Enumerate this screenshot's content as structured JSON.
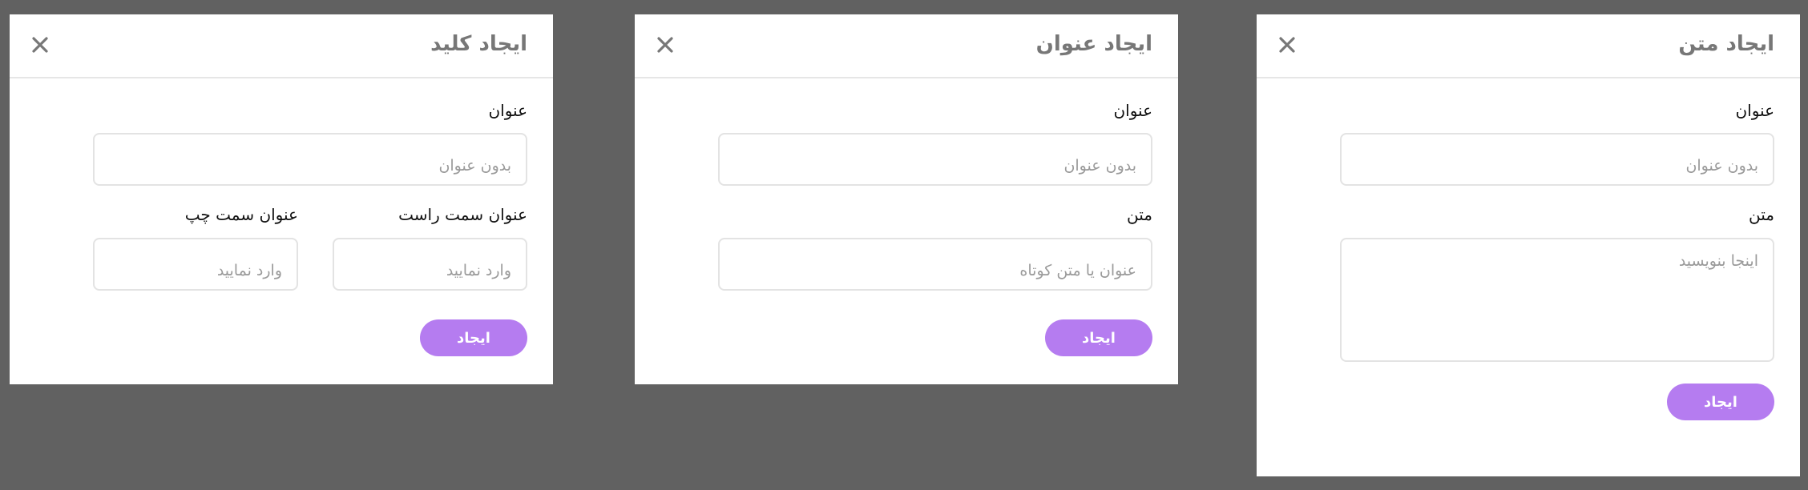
{
  "colors": {
    "backdrop": "#616161",
    "dialog_background": "#ffffff",
    "accent": "#b57cf0",
    "header_text": "#777777",
    "border": "#e3e3e3"
  },
  "dialogs": {
    "key": {
      "title": "ایجاد کلید",
      "close_icon": "close-icon",
      "fields": [
        {
          "label": "عنوان",
          "placeholder": "بدون عنوان",
          "value": ""
        },
        {
          "label": "عنوان سمت راست",
          "placeholder": "وارد نمایید",
          "value": ""
        },
        {
          "label": "عنوان سمت چپ",
          "placeholder": "وارد نمایید",
          "value": ""
        }
      ],
      "submit_label": "ایجاد"
    },
    "title": {
      "title": "ایجاد عنوان",
      "close_icon": "close-icon",
      "fields": [
        {
          "label": "عنوان",
          "placeholder": "بدون عنوان",
          "value": ""
        },
        {
          "label": "متن",
          "placeholder": "عنوان یا متن کوتاه",
          "value": ""
        }
      ],
      "submit_label": "ایجاد"
    },
    "text": {
      "title": "ایجاد متن",
      "close_icon": "close-icon",
      "fields": [
        {
          "label": "عنوان",
          "placeholder": "بدون عنوان",
          "value": ""
        },
        {
          "label": "متن",
          "placeholder": "اینجا بنویسید",
          "value": ""
        }
      ],
      "submit_label": "ایجاد"
    }
  }
}
